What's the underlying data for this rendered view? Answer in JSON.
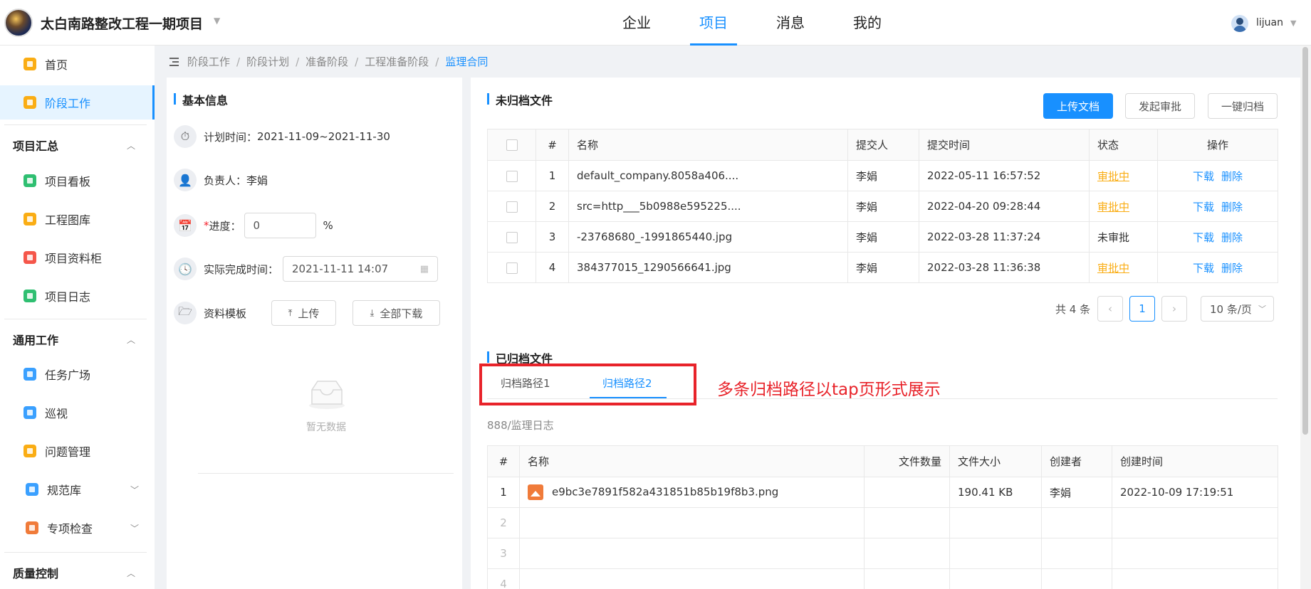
{
  "header": {
    "project_title": "太白南路整改工程一期项目",
    "nav": [
      "企业",
      "项目",
      "消息",
      "我的"
    ],
    "active_nav": "项目",
    "username": "lijuan"
  },
  "sidebar": {
    "top_items": [
      {
        "label": "首页",
        "icon": "home-icon",
        "color": "#faad14"
      },
      {
        "label": "阶段工作",
        "icon": "list-icon",
        "color": "#faad14",
        "active": true
      }
    ],
    "groups": [
      {
        "title": "项目汇总",
        "items": [
          {
            "label": "项目看板",
            "icon": "dashboard-icon",
            "color": "#2fbf71"
          },
          {
            "label": "工程图库",
            "icon": "image-icon",
            "color": "#faad14"
          },
          {
            "label": "项目资料柜",
            "icon": "cabinet-icon",
            "color": "#f5564a"
          },
          {
            "label": "项目日志",
            "icon": "log-icon",
            "color": "#2fbf71"
          }
        ]
      },
      {
        "title": "通用工作",
        "items": [
          {
            "label": "任务广场",
            "icon": "flag-icon",
            "color": "#3aa0ff"
          },
          {
            "label": "巡视",
            "icon": "eye-icon",
            "color": "#3aa0ff"
          },
          {
            "label": "问题管理",
            "icon": "bug-icon",
            "color": "#faad14"
          },
          {
            "label": "规范库",
            "icon": "book-icon",
            "color": "#3aa0ff"
          },
          {
            "label": "专项检查",
            "icon": "check-icon",
            "color": "#f07b3a"
          }
        ]
      },
      {
        "title": "质量控制",
        "items": []
      }
    ]
  },
  "breadcrumb": [
    "阶段工作",
    "阶段计划",
    "准备阶段",
    "工程准备阶段",
    "监理合同"
  ],
  "basic_info": {
    "title": "基本信息",
    "plan_time_label": "计划时间：",
    "plan_time": "2021-11-09~2021-11-30",
    "owner_label": "负责人：",
    "owner": "李娟",
    "progress_req": "*",
    "progress_label": "进度：",
    "progress_value": "0",
    "progress_unit": "%",
    "actual_time_label": "实际完成时间：",
    "actual_time": "2021-11-11 14:07",
    "template_label": "资料模板",
    "upload_label": "上传",
    "download_all_label": "全部下载",
    "empty_text": "暂无数据"
  },
  "unarchived": {
    "title": "未归档文件",
    "buttons": {
      "upload": "上传文档",
      "approve": "发起审批",
      "archive": "一键归档"
    },
    "columns": [
      "#",
      "名称",
      "提交人",
      "提交时间",
      "状态",
      "操作"
    ],
    "rows": [
      {
        "no": "1",
        "name": "default_company.8058a406....",
        "submitter": "李娟",
        "time": "2022-05-11 16:57:52",
        "status": "审批中",
        "status_link": true
      },
      {
        "no": "2",
        "name": "src=http___5b0988e595225....",
        "submitter": "李娟",
        "time": "2022-04-20 09:28:44",
        "status": "审批中",
        "status_link": true
      },
      {
        "no": "3",
        "name": "-23768680_-1991865440.jpg",
        "submitter": "李娟",
        "time": "2022-03-28 11:37:24",
        "status": "未审批",
        "status_link": false
      },
      {
        "no": "4",
        "name": "384377015_1290566641.jpg",
        "submitter": "李娟",
        "time": "2022-03-28 11:36:38",
        "status": "审批中",
        "status_link": true
      }
    ],
    "op_download": "下载",
    "op_delete": "删除",
    "pager": {
      "total": "共 4 条",
      "page": "1",
      "page_size": "10 条/页"
    }
  },
  "archived": {
    "title": "已归档文件",
    "tabs": [
      "归档路径1",
      "归档路径2"
    ],
    "active_tab": 1,
    "annotation": "多条归档路径以tap页形式展示",
    "path": "888/监理日志",
    "columns": [
      "#",
      "名称",
      "文件数量",
      "文件大小",
      "创建者",
      "创建时间"
    ],
    "rows": [
      {
        "no": "1",
        "name": "e9bc3e7891f582a431851b85b19f8b3.png",
        "count": "",
        "size": "190.41 KB",
        "creator": "李娟",
        "created": "2022-10-09 17:19:51"
      },
      {
        "no": "2"
      },
      {
        "no": "3"
      },
      {
        "no": "4"
      }
    ]
  }
}
